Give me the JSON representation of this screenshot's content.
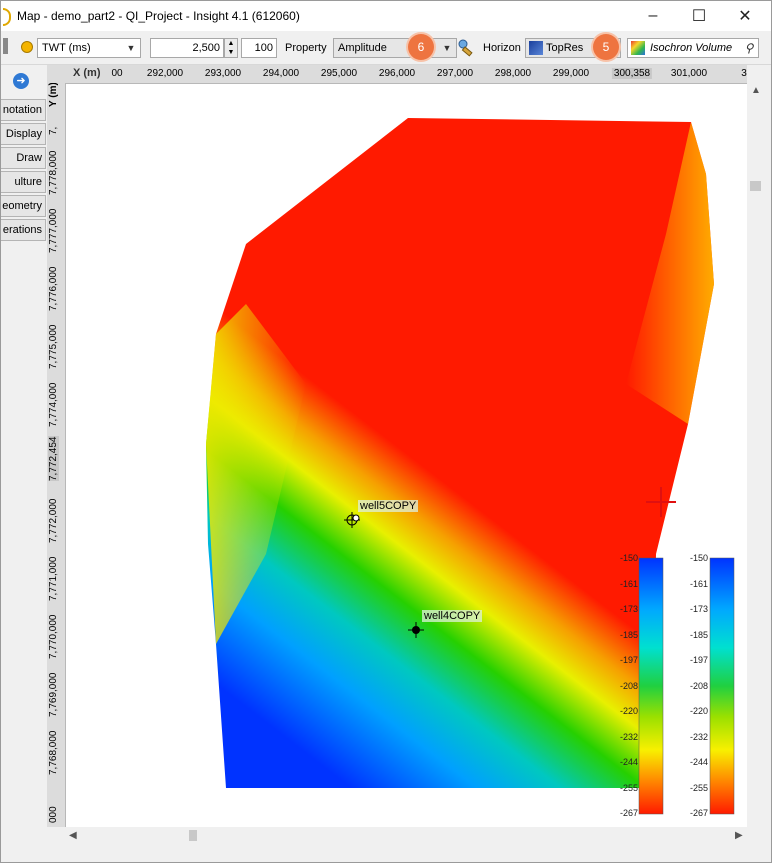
{
  "window": {
    "title": "Map - demo_part2 - QI_Project - Insight 4.1 (612060)",
    "minimize_glyph": "–",
    "maximize_glyph": "☐",
    "close_glyph": "✕"
  },
  "toolbar": {
    "domain_value": "TWT (ms)",
    "time_value": "2,500",
    "step_value": "100",
    "property_label": "Property",
    "property_value": "Amplitude",
    "horizon_label": "Horizon",
    "horizon_value": "TopRes",
    "volume_value": "Isochron Volume",
    "badge_property": "6",
    "badge_horizon": "5"
  },
  "sidebar": {
    "items": [
      "notation",
      "Display",
      "Draw",
      "ulture",
      "eometry",
      "erations"
    ]
  },
  "x_ruler": {
    "label": "X (m)",
    "ticks": [
      "00",
      "292,000",
      "293,000",
      "294,000",
      "295,000",
      "296,000",
      "297,000",
      "298,000",
      "299,000",
      "300,358",
      "301,000",
      "3"
    ]
  },
  "y_ruler": {
    "label": "Y (m)",
    "ticks": [
      "7,",
      "7,778,000",
      "7,777,000",
      "7,776,000",
      "7,775,000",
      "7,774,000",
      "7,772,454",
      "7,772,000",
      "7,771,000",
      "7,770,000",
      "7,769,000",
      "7,768,000",
      "000"
    ]
  },
  "map": {
    "wells": [
      {
        "name": "well5COPY"
      },
      {
        "name": "well4COPY"
      }
    ],
    "colorbar_ticks": [
      "-150",
      "-161",
      "-173",
      "-185",
      "-197",
      "-208",
      "-220",
      "-232",
      "-244",
      "-255",
      "-267"
    ],
    "colors": {
      "high": "#ff1a00",
      "mid": "#26d000",
      "low": "#0033ff"
    }
  }
}
